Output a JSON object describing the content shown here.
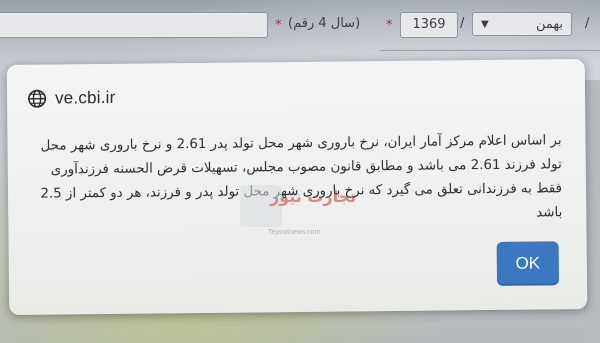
{
  "background_form": {
    "month_value": "بهمن",
    "separator_1": "/",
    "year_value": "1369",
    "separator_2": "/",
    "required_mark": "*",
    "year_hint": "(سال 4 رقم)",
    "required_mark_2": "*"
  },
  "dialog": {
    "site": "ve.cbi.ir",
    "message": "بر اساس اعلام مرکز آمار ایران، نرخ باروری شهر محل تولد پدر 2.61 و نرخ باروری شهر محل تولد فرزند 2.61 می باشد و مطابق قانون مصوب مجلس، تسهیلات قرض الحسنه فرزندآوری فقط به فرزندانی تعلق می گیرد که نرخ باروری شهر محل تولد پدر و فرزند، هر دو کمتر از 2.5 باشد",
    "ok_label": "OK"
  },
  "watermark": {
    "text": "تجارت نیوز",
    "url": "Tejaratnews.com"
  },
  "colors": {
    "ok_button": "#3b78c2",
    "watermark": "#c0392b"
  }
}
